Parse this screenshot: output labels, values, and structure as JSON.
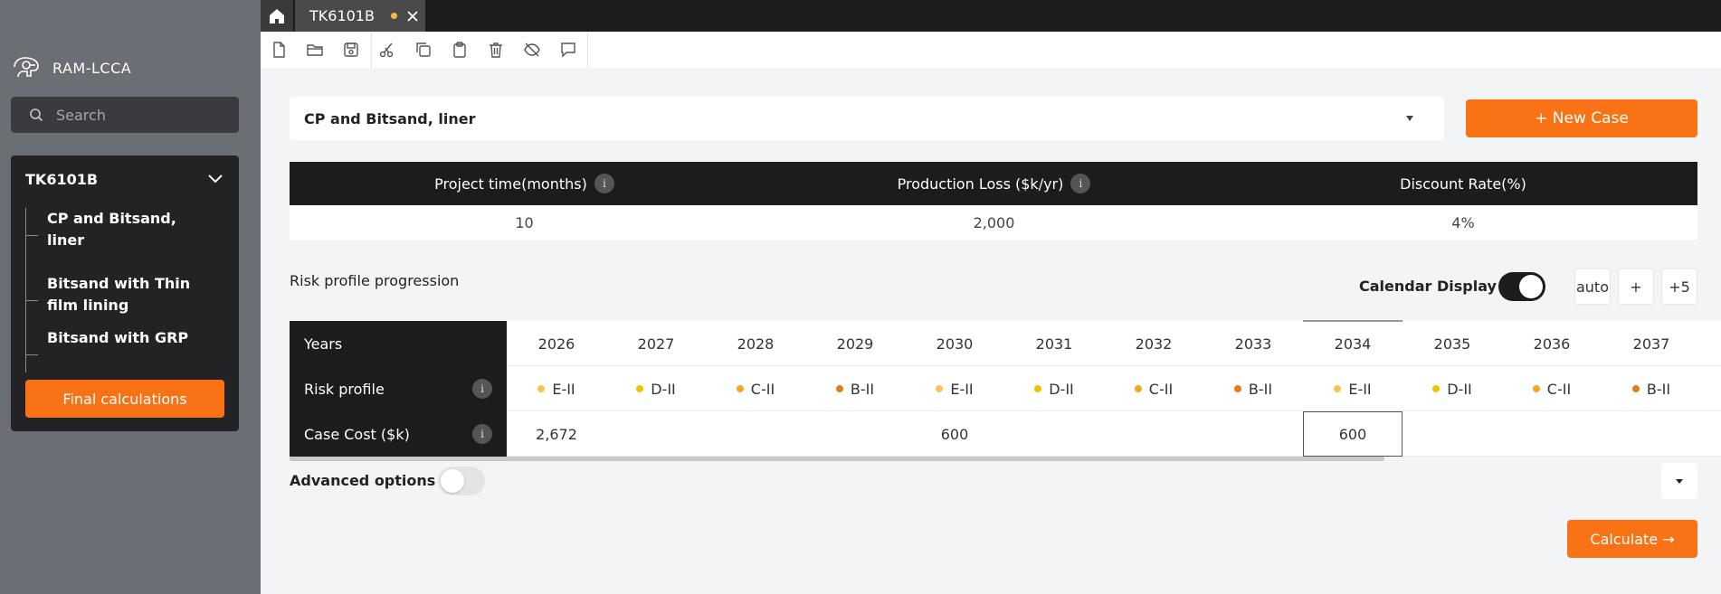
{
  "sidebar": {
    "app_name": "RAM-LCCA",
    "search_placeholder": "Search",
    "project": {
      "name": "TK6101B",
      "items": [
        {
          "label_line1": "CP and Bitsand,",
          "label_line2": "liner"
        },
        {
          "label_line1": "Bitsand with Thin",
          "label_line2": "film lining"
        },
        {
          "label_line1": "Bitsand with GRP",
          "label_line2": ""
        }
      ]
    },
    "final_button": "Final calculations"
  },
  "tabs": {
    "active_tab": "TK6101B",
    "modified": true
  },
  "toolbar": {
    "icons": [
      "new-file-icon",
      "open-folder-icon",
      "save-icon",
      "cut-icon",
      "copy-icon",
      "paste-icon",
      "delete-icon",
      "hide-icon",
      "comment-icon"
    ]
  },
  "main": {
    "case_select_value": "CP and Bitsand, liner",
    "new_case_button": "+ New Case",
    "params": {
      "headers": [
        "Project time(months)",
        "Production Loss ($k/yr)",
        "Discount Rate(%)"
      ],
      "values": [
        "10",
        "2,000",
        "4%"
      ]
    },
    "risk_title": "Risk profile progression",
    "calendar_label": "Calendar Display",
    "calendar_on": true,
    "zoom_buttons": [
      "auto",
      "+",
      "+5"
    ],
    "grid": {
      "row_labels": [
        "Years",
        "Risk profile",
        "Case Cost ($k)"
      ],
      "years": [
        "2026",
        "2027",
        "2028",
        "2029",
        "2030",
        "2031",
        "2032",
        "2033",
        "2034",
        "2035",
        "2036",
        "2037"
      ],
      "risk": [
        {
          "label": "E-II",
          "color": "#f5c451"
        },
        {
          "label": "D-II",
          "color": "#f2c200"
        },
        {
          "label": "C-II",
          "color": "#f4a81d"
        },
        {
          "label": "B-II",
          "color": "#e97c1a"
        },
        {
          "label": "E-II",
          "color": "#f5c451"
        },
        {
          "label": "D-II",
          "color": "#f2c200"
        },
        {
          "label": "C-II",
          "color": "#f4a81d"
        },
        {
          "label": "B-II",
          "color": "#e97c1a"
        },
        {
          "label": "E-II",
          "color": "#f5c451"
        },
        {
          "label": "D-II",
          "color": "#f2c200"
        },
        {
          "label": "C-II",
          "color": "#f4a81d"
        },
        {
          "label": "B-II",
          "color": "#e97c1a"
        }
      ],
      "costs": [
        {
          "value": "2,672",
          "col": 0
        },
        {
          "value": "600",
          "col": 4
        },
        {
          "value": "600",
          "col": 8,
          "selected": true
        }
      ]
    },
    "advanced_label": "Advanced options",
    "advanced_on": false,
    "calculate_button": "Calculate →"
  },
  "colors": {
    "accent": "#f97316",
    "dark": "#1c1c1c",
    "sidebar_bg": "#6b6e74"
  }
}
